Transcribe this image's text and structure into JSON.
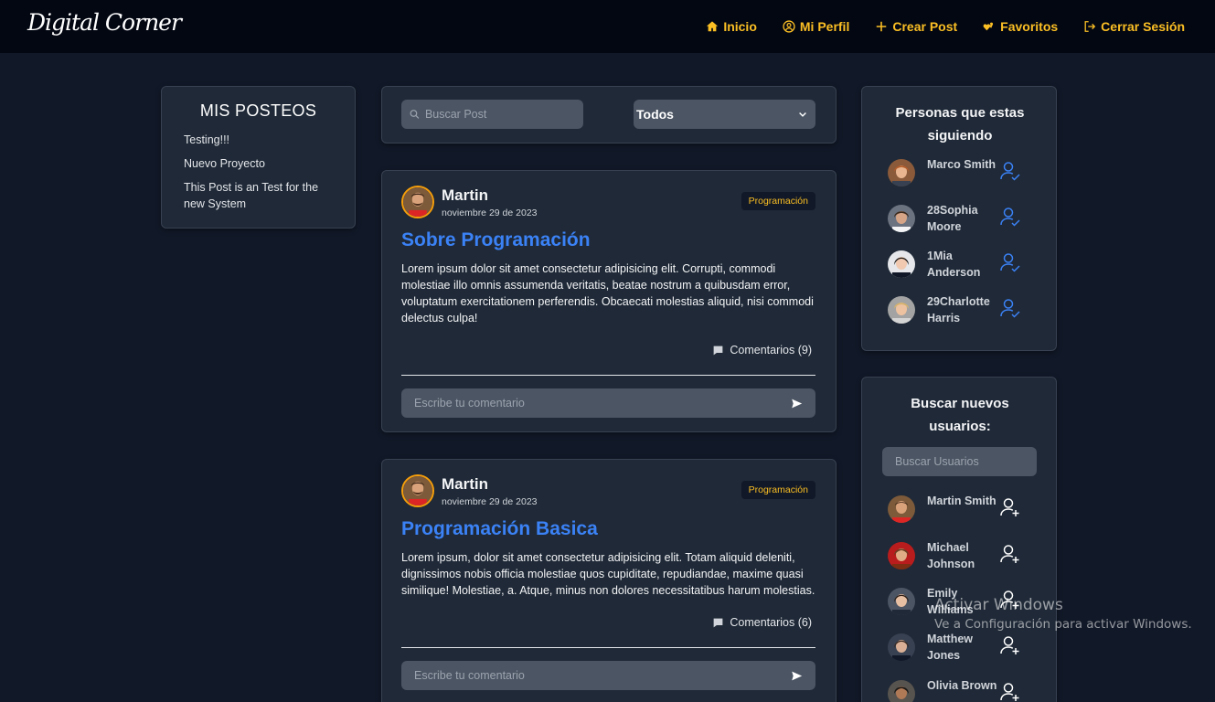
{
  "nav": {
    "logo": "Digital Corner",
    "links": [
      {
        "label": "Inicio",
        "icon": "home-icon"
      },
      {
        "label": "Mi Perfil",
        "icon": "user-circle-icon"
      },
      {
        "label": "Crear Post",
        "icon": "plus-icon"
      },
      {
        "label": "Favoritos",
        "icon": "hearts-icon"
      },
      {
        "label": "Cerrar Sesión",
        "icon": "logout-icon"
      }
    ]
  },
  "my_posts": {
    "title": "MIS POSTEOS",
    "items": [
      "Testing!!!",
      "Nuevo Proyecto",
      "This Post is an Test for the new System"
    ]
  },
  "search": {
    "placeholder": "Buscar Post",
    "filter_selected": "Todos"
  },
  "posts": [
    {
      "author": "Martin",
      "date": "noviembre 29 de 2023",
      "category": "Programación",
      "title": "Sobre Programación",
      "body": "Lorem ipsum dolor sit amet consectetur adipisicing elit. Corrupti, commodi molestiae illo omnis assumenda veritatis, beatae nostrum a quibusdam error, voluptatum exercitationem perferendis. Obcaecati molestias aliquid, nisi commodi delectus culpa!",
      "comments": "Comentarios (9)",
      "comment_placeholder": "Escribe tu comentario"
    },
    {
      "author": "Martin",
      "date": "noviembre 29 de 2023",
      "category": "Programación",
      "title": "Programación Basica",
      "body": "Lorem ipsum, dolor sit amet consectetur adipisicing elit. Totam aliquid deleniti, dignissimos nobis officia molestiae quos cupiditate, repudiandae, maxime quasi similique! Molestiae, a. Atque, minus non dolores necessitatibus harum molestias.",
      "comments": "Comentarios (6)",
      "comment_placeholder": "Escribe tu comentario"
    }
  ],
  "following": {
    "title": "Personas que estas siguiendo",
    "users": [
      {
        "name": "Marco Smith"
      },
      {
        "name": "28Sophia Moore"
      },
      {
        "name": "1Mia Anderson"
      },
      {
        "name": "29Charlotte Harris"
      }
    ]
  },
  "discover": {
    "title": "Buscar nuevos usuarios:",
    "placeholder": "Buscar Usuarios",
    "users": [
      {
        "name": "Martin Smith"
      },
      {
        "name": "Michael Johnson"
      },
      {
        "name": "Emily Williams"
      },
      {
        "name": "Matthew Jones"
      },
      {
        "name": "Olivia Brown"
      }
    ]
  },
  "watermark": {
    "title": "Activar Windows",
    "subtitle": "Ve a Configuración para activar Windows."
  },
  "colors": {
    "accent": "#fbbf24",
    "link_blue": "#3b82f6",
    "panel": "#1f2937",
    "background": "#111827"
  }
}
